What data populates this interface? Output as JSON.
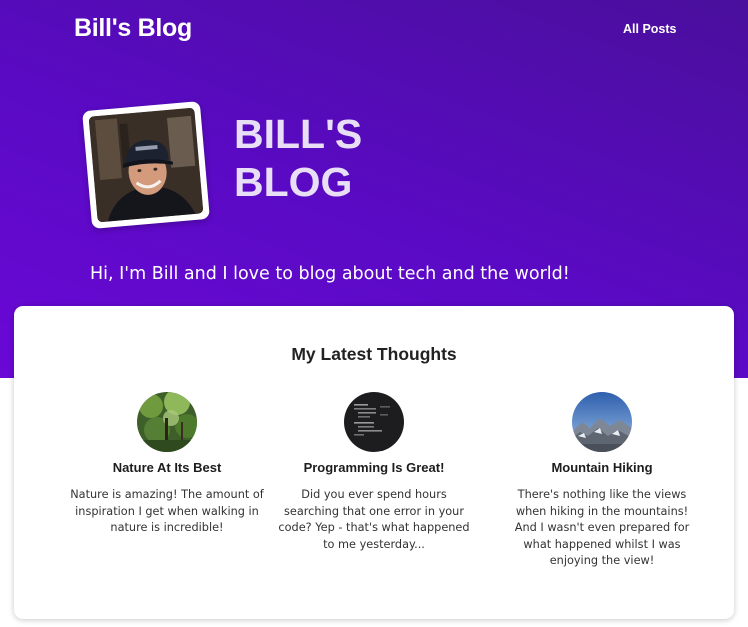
{
  "header": {
    "brand": "Bill's Blog",
    "nav": [
      {
        "label": "All Posts"
      }
    ]
  },
  "hero": {
    "title": "BILL'S BLOG",
    "subtitle": "Hi, I'm Bill and I love to blog about tech and the world!",
    "avatar": "profile-photo"
  },
  "latest": {
    "heading": "My Latest Thoughts",
    "posts": [
      {
        "title": "Nature At Its Best",
        "excerpt": "Nature is amazing! The amount of inspiration I get when walking in nature is incredible!",
        "thumbnail": "forest-photo"
      },
      {
        "title": "Programming Is Great!",
        "excerpt": "Did you ever spend hours searching that one error in your code? Yep - that's what happened to me yesterday...",
        "thumbnail": "code-screen-photo"
      },
      {
        "title": "Mountain Hiking",
        "excerpt": "There's nothing like the views when hiking in the mountains! And I wasn't even prepared for what happened whilst I was enjoying the view!",
        "thumbnail": "mountain-photo"
      }
    ]
  },
  "colors": {
    "hero_gradient_start": "#4a0f9c",
    "hero_gradient_end": "#6a08d6",
    "title_text": "#e8def6"
  }
}
